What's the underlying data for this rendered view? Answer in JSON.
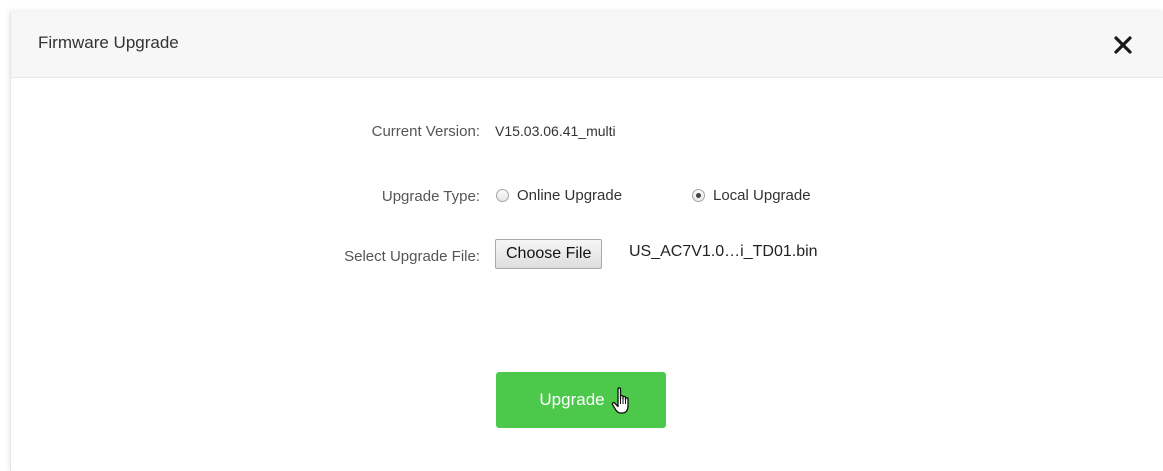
{
  "dialog": {
    "title": "Firmware Upgrade",
    "close_icon": "close-icon"
  },
  "form": {
    "current_version": {
      "label": "Current Version:",
      "value": "V15.03.06.41_multi"
    },
    "upgrade_type": {
      "label": "Upgrade Type:",
      "options": [
        {
          "label": "Online Upgrade",
          "checked": false
        },
        {
          "label": "Local Upgrade",
          "checked": true
        }
      ]
    },
    "upgrade_file": {
      "label": "Select Upgrade File:",
      "button_label": "Choose File",
      "file_name": "US_AC7V1.0…i_TD01.bin"
    }
  },
  "actions": {
    "upgrade_label": "Upgrade",
    "cursor_icon": "hand-pointer-icon"
  },
  "colors": {
    "upgrade_button": "#4cc84a",
    "header_bg": "#f7f7f7"
  }
}
